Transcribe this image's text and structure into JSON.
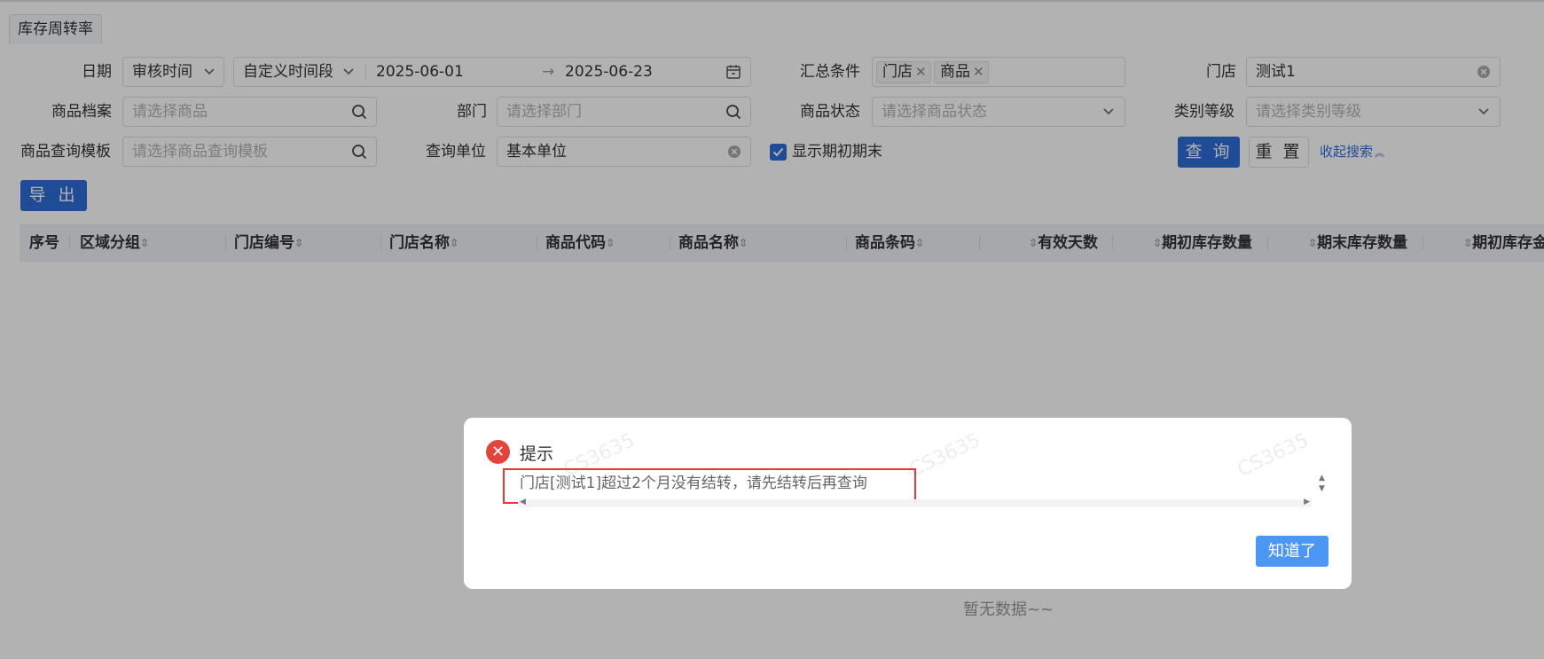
{
  "tab": {
    "label": "库存周转率"
  },
  "filters": {
    "date": {
      "label": "日期",
      "type_value": "审核时间",
      "range_value": "自定义时间段",
      "start": "2025-06-01",
      "end": "2025-06-23",
      "separator": "→"
    },
    "summary": {
      "label": "汇总条件",
      "tags": [
        "门店",
        "商品"
      ]
    },
    "store": {
      "label": "门店",
      "value": "测试1"
    },
    "product": {
      "label": "商品档案",
      "placeholder": "请选择商品"
    },
    "dept": {
      "label": "部门",
      "placeholder": "请选择部门"
    },
    "product_status": {
      "label": "商品状态",
      "placeholder": "请选择商品状态"
    },
    "category_level": {
      "label": "类别等级",
      "placeholder": "请选择类别等级"
    },
    "query_template": {
      "label": "商品查询模板",
      "placeholder": "请选择商品查询模板"
    },
    "query_unit": {
      "label": "查询单位",
      "value": "基本单位"
    },
    "show_period": {
      "label": "显示期初期末",
      "checked": true
    }
  },
  "buttons": {
    "query": "查 询",
    "reset": "重 置",
    "collapse": "收起搜索",
    "export": "导 出"
  },
  "table": {
    "columns": [
      "序号",
      "区域分组",
      "门店编号",
      "门店名称",
      "商品代码",
      "商品名称",
      "商品条码",
      "有效天数",
      "期初库存数量",
      "期末库存数量",
      "期初库存金"
    ],
    "empty_text": "暂无数据~~"
  },
  "dialog": {
    "title": "提示",
    "message": "门店[测试1]超过2个月没有结转，请先结转后再查询",
    "confirm": "知道了",
    "watermark": "CS3635"
  },
  "icons": {
    "error": "close-circle-icon",
    "search": "search-icon",
    "calendar": "calendar-icon"
  },
  "colors": {
    "primary": "#2f6ed8",
    "dialog_button": "#4c97f4",
    "error": "#e5443b",
    "highlight": "#e53935"
  }
}
